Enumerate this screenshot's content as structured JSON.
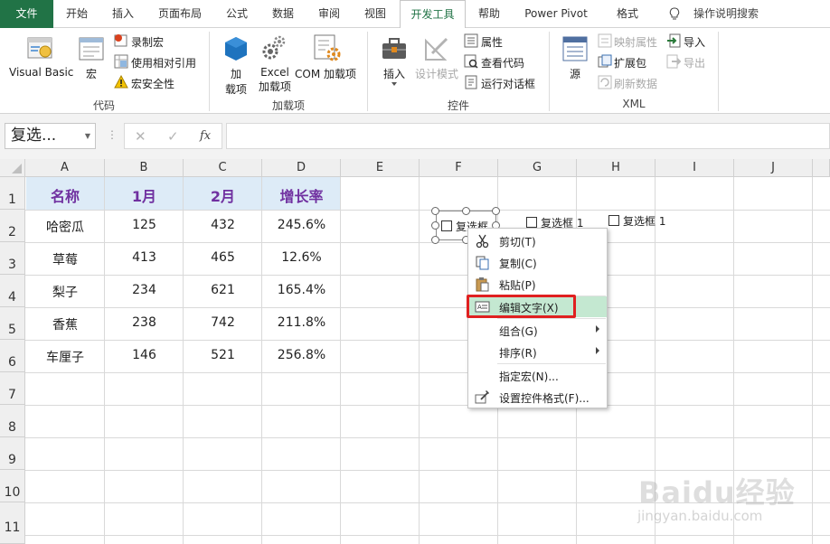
{
  "tabs": {
    "file": "文件",
    "home": "开始",
    "insert": "插入",
    "page_layout": "页面布局",
    "formulas": "公式",
    "data": "数据",
    "review": "审阅",
    "view": "视图",
    "developer": "开发工具",
    "help": "帮助",
    "power_pivot": "Power Pivot",
    "format": "格式",
    "tell_me": "操作说明搜索"
  },
  "ribbon": {
    "code_group": {
      "label": "代码",
      "visual_basic": "Visual Basic",
      "macros": "宏",
      "record_macro": "录制宏",
      "relative_refs": "使用相对引用",
      "macro_security": "宏安全性"
    },
    "addins_group": {
      "label": "加载项",
      "addins_line1": "加",
      "addins_line2": "载项",
      "excel_addins_line1": "Excel",
      "excel_addins_line2": "加载项",
      "com_addins": "COM 加载项"
    },
    "controls_group": {
      "label": "控件",
      "insert": "插入",
      "design_mode": "设计模式",
      "properties": "属性",
      "view_code": "查看代码",
      "run_dialog": "运行对话框"
    },
    "xml_group": {
      "label": "XML",
      "source": "源",
      "map_properties": "映射属性",
      "expansion_packs": "扩展包",
      "refresh_data": "刷新数据",
      "import": "导入",
      "export": "导出"
    }
  },
  "formula_bar": {
    "name_box": "复选...",
    "cancel": "✕",
    "enter": "✓",
    "fx": "fx",
    "formula": ""
  },
  "columns": [
    "A",
    "B",
    "C",
    "D",
    "E",
    "F",
    "G",
    "H",
    "I",
    "J"
  ],
  "rows": [
    "1",
    "2",
    "3",
    "4",
    "5",
    "6",
    "7",
    "8",
    "9",
    "10",
    "11"
  ],
  "table": {
    "headers": [
      "名称",
      "1月",
      "2月",
      "增长率"
    ],
    "rows": [
      [
        "哈密瓜",
        "125",
        "432",
        "245.6%"
      ],
      [
        "草莓",
        "413",
        "465",
        "12.6%"
      ],
      [
        "梨子",
        "234",
        "621",
        "165.4%"
      ],
      [
        "香蕉",
        "238",
        "742",
        "211.8%"
      ],
      [
        "车厘子",
        "146",
        "521",
        "256.8%"
      ]
    ]
  },
  "checkboxes": {
    "selected": "复选框",
    "cb2": "复选框 1",
    "cb3": "复选框 1"
  },
  "context_menu": {
    "cut": "剪切(T)",
    "copy": "复制(C)",
    "paste": "粘贴(P)",
    "edit_text": "编辑文字(X)",
    "group": "组合(G)",
    "order": "排序(R)",
    "assign_macro": "指定宏(N)...",
    "format_control": "设置控件格式(F)..."
  },
  "watermark": {
    "logo": "Baidu经验",
    "url": "jingyan.baidu.com"
  },
  "colors": {
    "file_tab": "#217346",
    "table_header_fill": "#ddebf7",
    "table_header_text": "#7030a0",
    "menu_highlight": "#c4e8d1",
    "callout": "#e02020"
  }
}
